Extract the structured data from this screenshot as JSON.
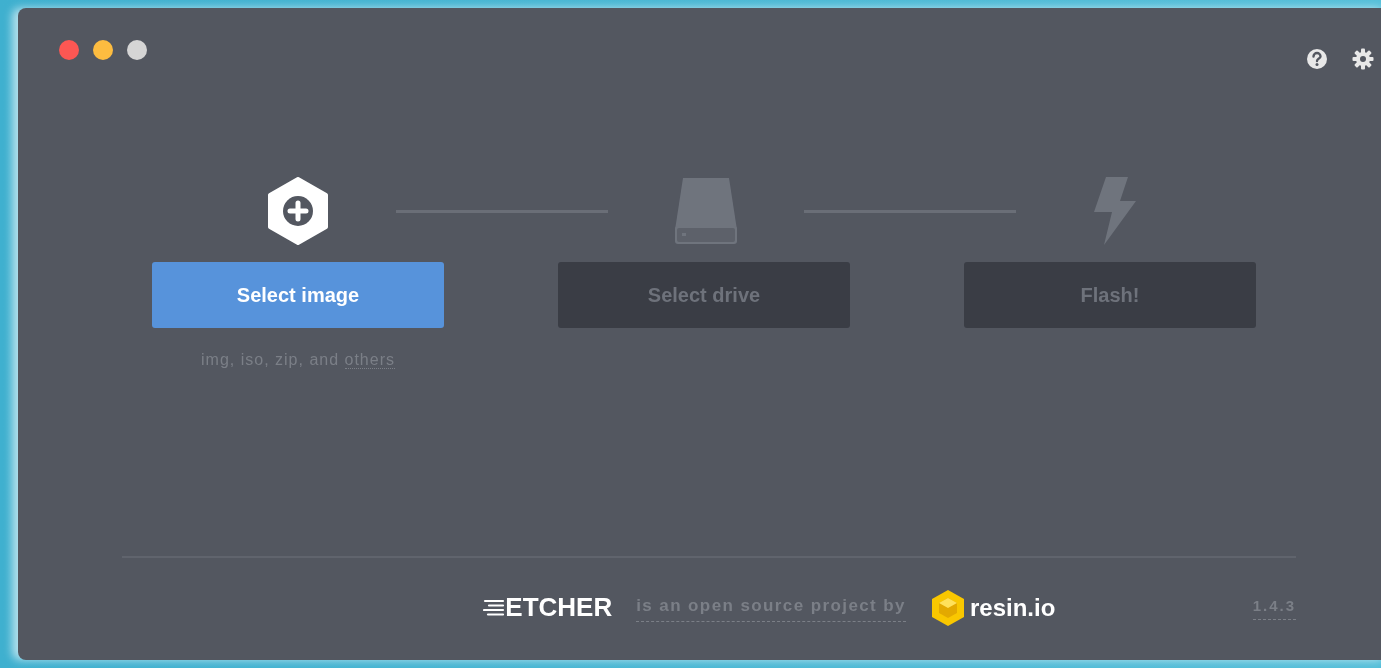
{
  "window": {
    "controls": [
      {
        "color": "#fc5753"
      },
      {
        "color": "#fdbc40"
      },
      {
        "color": "#d5d5d5"
      }
    ]
  },
  "steps": [
    {
      "kind": "image",
      "label": "Select image",
      "disabled": false,
      "hint": "img, iso, zip, and ",
      "hint_link": "others"
    },
    {
      "kind": "drive",
      "label": "Select drive",
      "disabled": true
    },
    {
      "kind": "flash",
      "label": "Flash!",
      "disabled": true
    }
  ],
  "footer": {
    "logo": "ETCHER",
    "tagline": "is an open source project by",
    "brand": "resin.io",
    "version": "1.4.3"
  }
}
